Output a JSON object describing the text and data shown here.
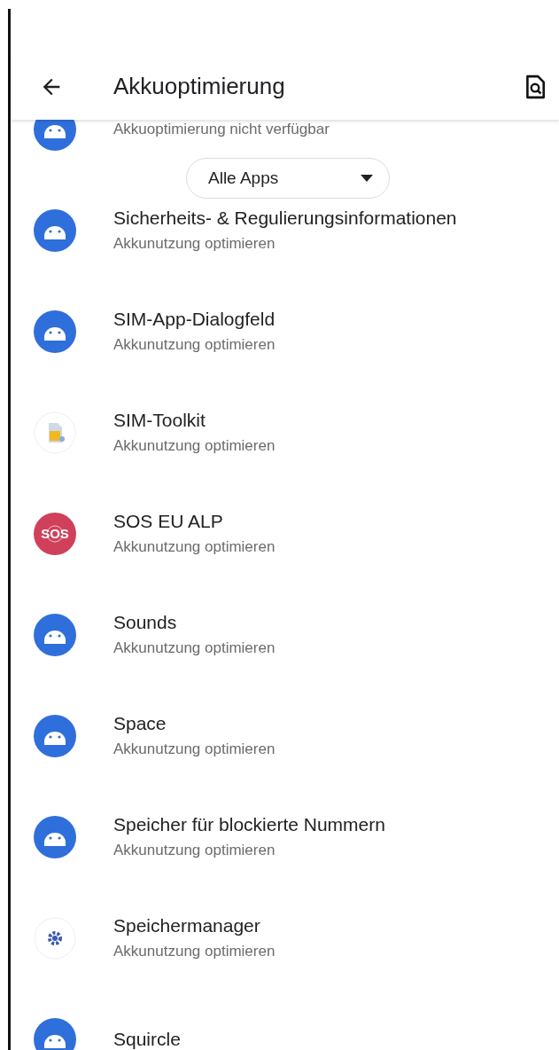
{
  "header": {
    "title": "Akkuoptimierung"
  },
  "filter": {
    "label": "Alle Apps"
  },
  "apps": [
    {
      "kind": "android",
      "subtitle": "Akkuoptimierung nicht verfügbar"
    },
    {
      "kind": "android",
      "title": "Sicherheits- & Regulierungsinformationen",
      "subtitle": "Akkunutzung optimieren"
    },
    {
      "kind": "android",
      "title": "SIM-App-Dialogfeld",
      "subtitle": "Akkunutzung optimieren"
    },
    {
      "kind": "sim",
      "title": "SIM-Toolkit",
      "subtitle": "Akkunutzung optimieren"
    },
    {
      "kind": "sos",
      "title": "SOS EU ALP",
      "subtitle": "Akkunutzung optimieren",
      "icon_text": "SOS"
    },
    {
      "kind": "android",
      "title": "Sounds",
      "subtitle": "Akkunutzung optimieren"
    },
    {
      "kind": "android",
      "title": "Space",
      "subtitle": "Akkunutzung optimieren"
    },
    {
      "kind": "android",
      "title": "Speicher für blockierte Nummern",
      "subtitle": "Akkunutzung optimieren"
    },
    {
      "kind": "storage",
      "title": "Speichermanager",
      "subtitle": "Akkunutzung optimieren"
    },
    {
      "kind": "android",
      "title": "Squircle"
    }
  ]
}
